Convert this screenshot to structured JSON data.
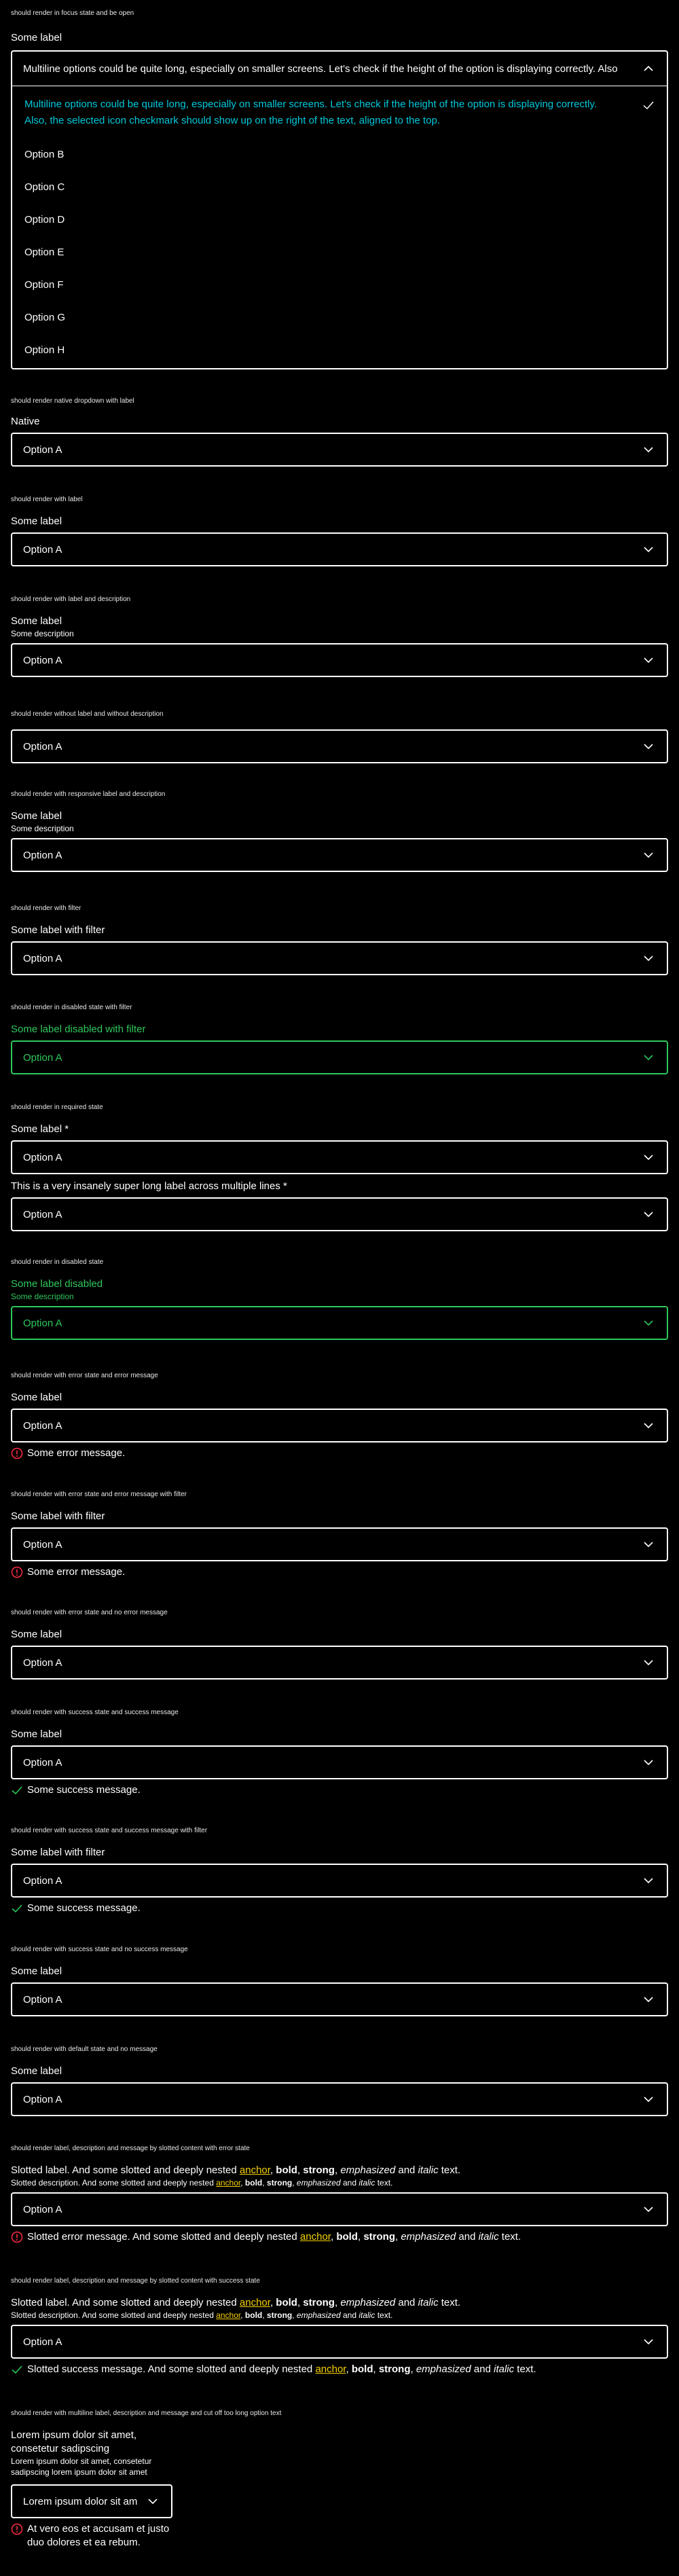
{
  "colors": {
    "accent": "#00c9dc",
    "success": "#2ec75c",
    "error": "#ff2d44",
    "link": "#f5d000"
  },
  "open": {
    "caption": "should render in focus state and be open",
    "label": "Some label",
    "value": "Multiline options could be quite long, especially on smaller screens. Let's check if the height of the option is displaying correctly. Also",
    "options": [
      "Multiline options could be quite long, especially on smaller screens. Let's check if the height of the option is displaying correctly. Also, the selected icon checkmark should show up on the right of the text, aligned to the top.",
      "Option B",
      "Option C",
      "Option D",
      "Option E",
      "Option F",
      "Option G",
      "Option H"
    ]
  },
  "native": {
    "caption": "should render native dropdown with label",
    "label": "Native",
    "value": "Option A"
  },
  "with_label": {
    "caption": "should render with label",
    "label": "Some label",
    "value": "Option A"
  },
  "label_desc": {
    "caption": "should render with label and description",
    "label": "Some label",
    "description": "Some description",
    "value": "Option A"
  },
  "no_label": {
    "caption": "should render without label and without description",
    "value": "Option A"
  },
  "responsive": {
    "caption": "should render with responsive label and description",
    "label": "Some label",
    "description": "Some description",
    "value": "Option A"
  },
  "filter": {
    "caption": "should render with filter",
    "label": "Some label with filter",
    "value": "Option A"
  },
  "disabled_filter": {
    "caption": "should render in disabled state with filter",
    "label": "Some label disabled with filter",
    "value": "Option A"
  },
  "required": {
    "caption": "should render in required state",
    "label": "Some label *",
    "value": "Option A",
    "label2": "This is a very insanely super long label across multiple lines *",
    "value2": "Option A"
  },
  "disabled": {
    "caption": "should render in disabled state",
    "label": "Some label disabled",
    "description": "Some description",
    "value": "Option A"
  },
  "error": {
    "caption": "should render with error state and error message",
    "label": "Some label",
    "value": "Option A",
    "message": "Some error message."
  },
  "error_filter": {
    "caption": "should render with error state and error message with filter",
    "label": "Some label with filter",
    "value": "Option A",
    "message": "Some error message."
  },
  "error_nomsg": {
    "caption": "should render with error state and no error message",
    "label": "Some label",
    "value": "Option A"
  },
  "success": {
    "caption": "should render with success state and success message",
    "label": "Some label",
    "value": "Option A",
    "message": "Some success message."
  },
  "success_filter": {
    "caption": "should render with success state and success message with filter",
    "label": "Some label with filter",
    "value": "Option A",
    "message": "Some success message."
  },
  "success_nomsg": {
    "caption": "should render with success state and no success message",
    "label": "Some label",
    "value": "Option A"
  },
  "default_nomsg": {
    "caption": "should render with default state and no message",
    "label": "Some label",
    "value": "Option A"
  },
  "slotted_error": {
    "caption": "should render label, description and message by slotted content with error state",
    "value": "Option A",
    "label_pre": "Slotted label. And some slotted and deeply nested ",
    "desc_pre": "Slotted description. And some slotted and deeply nested ",
    "msg_pre": "Slotted error message. And some slotted and deeply nested ",
    "anchor": "anchor",
    "bold": "bold",
    "strong": "strong",
    "emph": "emphasized",
    "and": " and ",
    "italic": "italic",
    "text": " text."
  },
  "slotted_success": {
    "caption": "should render label, description and message by slotted content with success state",
    "value": "Option A",
    "label_pre": "Slotted label. And some slotted and deeply nested ",
    "desc_pre": "Slotted description. And some slotted and deeply nested ",
    "msg_pre": "Slotted success message. And some slotted and deeply nested ",
    "anchor": "anchor",
    "bold": "bold",
    "strong": "strong",
    "emph": "emphasized",
    "and": " and ",
    "italic": "italic",
    "text": " text."
  },
  "multiline": {
    "caption": "should render with multiline label, description and message and cut off too long option text",
    "label_l1": "Lorem ipsum dolor sit amet,",
    "label_l2": "consetetur sadipscing",
    "desc_l1": "Lorem ipsum dolor sit amet, consetetur",
    "desc_l2": "sadipscing lorem ipsum dolor sit amet",
    "value": "Lorem ipsum dolor sit am",
    "msg_l1": "At vero eos et accusam et justo",
    "msg_l2": "duo dolores et ea rebum."
  }
}
